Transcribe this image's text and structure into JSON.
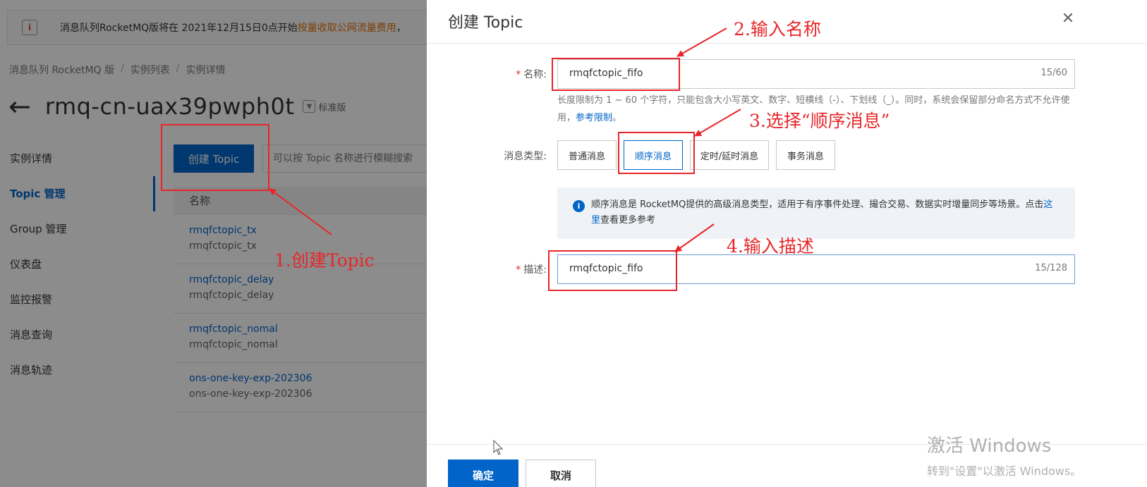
{
  "background": {
    "notice": {
      "icon": "info-banner-icon",
      "text": "消息队列RocketMQ版将在 2021年12月15日0点开始",
      "link": "按量收取公网流量费用",
      "tail": "，"
    },
    "breadcrumb": [
      "消息队列 RocketMQ 版",
      "实例列表",
      "实例详情"
    ],
    "instance_title": "rmq-cn-uax39pwph0t",
    "edition": "标准版",
    "side_nav": [
      "实例详情",
      "Topic 管理",
      "Group 管理",
      "仪表盘",
      "监控报警",
      "消息查询",
      "消息轨迹"
    ],
    "create_topic_button": "创建 Topic",
    "search_placeholder": "可以按 Topic 名称进行模糊搜索",
    "table_header": "名称",
    "topics": [
      {
        "name": "rmqfctopic_tx",
        "desc": "rmqfctopic_tx"
      },
      {
        "name": "rmqfctopic_delay",
        "desc": "rmqfctopic_delay"
      },
      {
        "name": "rmqfctopic_nomal",
        "desc": "rmqfctopic_nomal"
      },
      {
        "name": "ons-one-key-exp-202306",
        "desc": "ons-one-key-exp-202306"
      }
    ]
  },
  "drawer": {
    "title": "创建 Topic",
    "name_field": {
      "label": "名称:",
      "value": "rmqfctopic_fifo",
      "count": "15/60",
      "help": "长度限制为 1 ~ 60 个字符，只能包含大小写英文、数字、短横线（-）、下划线（_）。同时，系统会保留部分命名方式不允许使用，",
      "help_link": "参考限制",
      "help_tail": "。"
    },
    "type_field": {
      "label": "消息类型:",
      "options": [
        "普通消息",
        "顺序消息",
        "定时/延时消息",
        "事务消息"
      ],
      "selected": "顺序消息"
    },
    "info": {
      "text": "顺序消息是 RocketMQ提供的高级消息类型，适用于有序事件处理、撮合交易、数据实时增量同步等场景。点击",
      "link": "这里",
      "tail": "查看更多参考"
    },
    "desc_field": {
      "label": "描述:",
      "value": "rmqfctopic_fifo",
      "count": "15/128"
    },
    "ok_button": "确定",
    "cancel_button": "取消"
  },
  "watermark": {
    "title": "激活 Windows",
    "subtitle": "转到\"设置\"以激活 Windows。"
  },
  "annotations": {
    "step1": "1.创建Topic",
    "step2": "2.输入名称",
    "step3": "3.选择“顺序消息”",
    "step4": "4.输入描述",
    "color": "#e8262a"
  },
  "colors": {
    "primary": "#0064c8",
    "required": "#d93026",
    "notice_link": "#e6730f"
  }
}
